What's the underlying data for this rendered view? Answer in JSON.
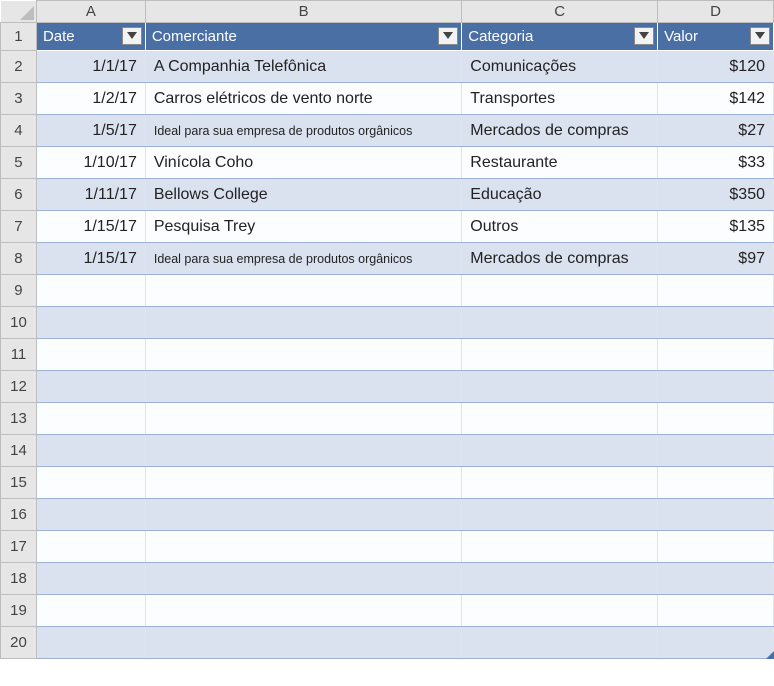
{
  "columns": [
    "A",
    "B",
    "C",
    "D"
  ],
  "rowCount": 20,
  "header": {
    "A": "Date",
    "B": "Comerciante",
    "C": "Categoria",
    "D": "Valor"
  },
  "rows": [
    {
      "date": "1/1/17",
      "merchant": "A Companhia Telefônica",
      "merchantSmall": false,
      "category": "Comunicações",
      "value": "$120"
    },
    {
      "date": "1/2/17",
      "merchant": "Carros elétricos de vento norte",
      "merchantSmall": false,
      "category": "Transportes",
      "value": "$142"
    },
    {
      "date": "1/5/17",
      "merchant": "Ideal para sua empresa de produtos orgânicos",
      "merchantSmall": true,
      "category": "Mercados de compras",
      "value": "$27"
    },
    {
      "date": "1/10/17",
      "merchant": "Vinícola Coho",
      "merchantSmall": false,
      "category": "Restaurante",
      "value": "$33"
    },
    {
      "date": "1/11/17",
      "merchant": "Bellows College",
      "merchantSmall": false,
      "category": "Educação",
      "value": "$350"
    },
    {
      "date": "1/15/17",
      "merchant": "Pesquisa Trey",
      "merchantSmall": false,
      "category": "Outros",
      "value": "$135"
    },
    {
      "date": "1/15/17",
      "merchant": "Ideal para sua empresa de produtos orgânicos",
      "merchantSmall": true,
      "category": "Mercados de compras",
      "value": "$97"
    }
  ]
}
